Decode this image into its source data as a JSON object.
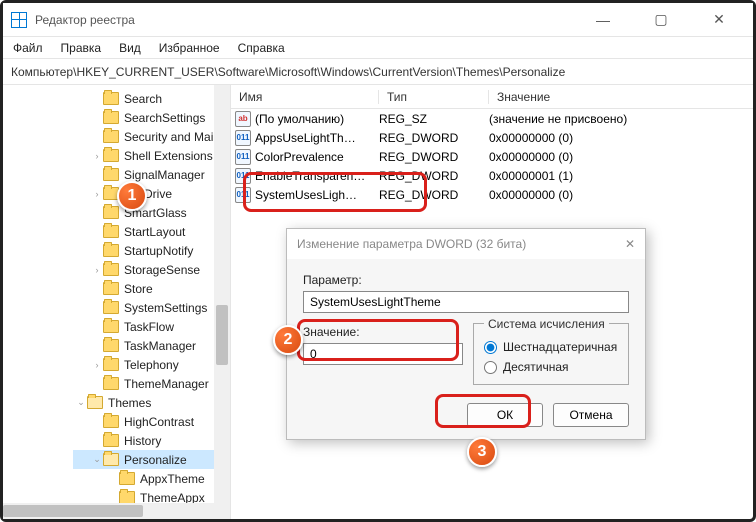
{
  "window": {
    "title": "Редактор реестра",
    "minimize": "—",
    "maximize": "▢",
    "close": "✕"
  },
  "menu": [
    "Файл",
    "Правка",
    "Вид",
    "Избранное",
    "Справка"
  ],
  "address": "Компьютер\\HKEY_CURRENT_USER\\Software\\Microsoft\\Windows\\CurrentVersion\\Themes\\Personalize",
  "tree": [
    {
      "label": "Search",
      "lvl": "l1"
    },
    {
      "label": "SearchSettings",
      "lvl": "l1"
    },
    {
      "label": "Security and Maint",
      "lvl": "l1"
    },
    {
      "label": "Shell Extensions",
      "lvl": "l1",
      "chev": "›"
    },
    {
      "label": "SignalManager",
      "lvl": "l1"
    },
    {
      "label": "SkyDrive",
      "lvl": "l1",
      "chev": "›"
    },
    {
      "label": "SmartGlass",
      "lvl": "l1"
    },
    {
      "label": "StartLayout",
      "lvl": "l1"
    },
    {
      "label": "StartupNotify",
      "lvl": "l1"
    },
    {
      "label": "StorageSense",
      "lvl": "l1",
      "chev": "›"
    },
    {
      "label": "Store",
      "lvl": "l1"
    },
    {
      "label": "SystemSettings",
      "lvl": "l1"
    },
    {
      "label": "TaskFlow",
      "lvl": "l1"
    },
    {
      "label": "TaskManager",
      "lvl": "l1"
    },
    {
      "label": "Telephony",
      "lvl": "l1",
      "chev": "›"
    },
    {
      "label": "ThemeManager",
      "lvl": "l1"
    },
    {
      "label": "Themes",
      "lvl": "l0",
      "chev": "⌄",
      "open": true
    },
    {
      "label": "HighContrast",
      "lvl": "l1"
    },
    {
      "label": "History",
      "lvl": "l1"
    },
    {
      "label": "Personalize",
      "lvl": "l1",
      "chev": "⌄",
      "open": true,
      "sel": true
    },
    {
      "label": "AppxTheme",
      "lvl": "l2"
    },
    {
      "label": "ThemeAppx",
      "lvl": "l2"
    }
  ],
  "columns": {
    "name": "Имя",
    "type": "Тип",
    "data": "Значение"
  },
  "values": [
    {
      "icon": "ab",
      "name": "(По умолчанию)",
      "type": "REG_SZ",
      "data": "(значение не присвоено)"
    },
    {
      "icon": "dw",
      "name": "AppsUseLightTh…",
      "type": "REG_DWORD",
      "data": "0x00000000 (0)"
    },
    {
      "icon": "dw",
      "name": "ColorPrevalence",
      "type": "REG_DWORD",
      "data": "0x00000000 (0)"
    },
    {
      "icon": "dw",
      "name": "EnableTransparen…",
      "type": "REG_DWORD",
      "data": "0x00000001 (1)"
    },
    {
      "icon": "dw",
      "name": "SystemUsesLigh…",
      "type": "REG_DWORD",
      "data": "0x00000000 (0)"
    }
  ],
  "dialog": {
    "title": "Изменение параметра DWORD (32 бита)",
    "close": "✕",
    "param_label": "Параметр:",
    "param_value": "SystemUsesLightTheme",
    "value_label": "Значение:",
    "value": "0",
    "base_label": "Система исчисления",
    "radio_hex": "Шестнадцатеричная",
    "radio_dec": "Десятичная",
    "ok": "ОК",
    "cancel": "Отмена"
  },
  "callouts": {
    "c1": "1",
    "c2": "2",
    "c3": "3"
  }
}
